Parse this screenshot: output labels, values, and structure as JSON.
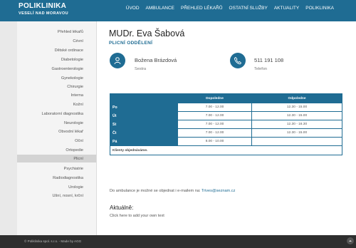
{
  "header": {
    "logo_title": "POLIKLINIKA",
    "logo_subtitle": "VESELÍ NAD MORAVOU",
    "nav": [
      "ÚVOD",
      "AMBULANCE",
      "PŘEHLED LÉKAŘŮ",
      "OSTATNÍ SLUŽBY",
      "AKTUALITY",
      "POLIKLINIKA"
    ]
  },
  "sidebar": {
    "items": [
      "Přehled lékařů",
      "Cévní",
      "Dětské ordinace",
      "Diabetologie",
      "Gastroenterologie",
      "Gynekologie",
      "Chirurgie",
      "Interna",
      "Kožní",
      "Laboratorní diagnostika",
      "Neurologie",
      "Obvodní lékař",
      "Oční",
      "Ortopedie",
      "Plicní",
      "Psychiatrie",
      "Radiodiagnostika",
      "Urologie",
      "Ušní, nosní, krční"
    ],
    "active_item": "Plicní"
  },
  "main": {
    "doctor_name": "MUDr. Eva Šabová",
    "department": "PLICNÍ ODDĚLENÍ",
    "contact_person": {
      "icon": "person-icon",
      "name": "Božena Brázdová",
      "role": "Sestra"
    },
    "phone": {
      "icon": "phone-icon",
      "number": "511 191 108",
      "label": "Telefon"
    },
    "hours_table": {
      "headers": [
        "",
        "Dopoledne",
        "Odpoledne"
      ],
      "rows": [
        {
          "day": "Po",
          "morning": "7.00 - 12.00",
          "afternoon": "12.30 - 15.00"
        },
        {
          "day": "Út",
          "morning": "7.00 - 12.00",
          "afternoon": "12.30 - 15.00"
        },
        {
          "day": "St",
          "morning": "7.00 - 12.00",
          "afternoon": "12.30 - 16.30"
        },
        {
          "day": "Čt",
          "morning": "7.00 - 12.00",
          "afternoon": "12.30 - 15.00"
        },
        {
          "day": "Pá",
          "morning": "8.00 - 10.00",
          "afternoon": ""
        }
      ],
      "note": "Klienty objednáváme."
    },
    "order_text": "Do ambulance je možné se objednat i e-mailem na:",
    "order_email": "Trives@seznam.cz",
    "news_title": "Aktuálně:",
    "news_placeholder": "Click here to add your own text"
  },
  "footer": {
    "text": "© Poliklinika spol. s.r.o. - Made by AGG"
  },
  "colors": {
    "brand": "#1f6c93",
    "footer": "#2e2e2e",
    "sidebar_active": "#d3d3d3"
  }
}
